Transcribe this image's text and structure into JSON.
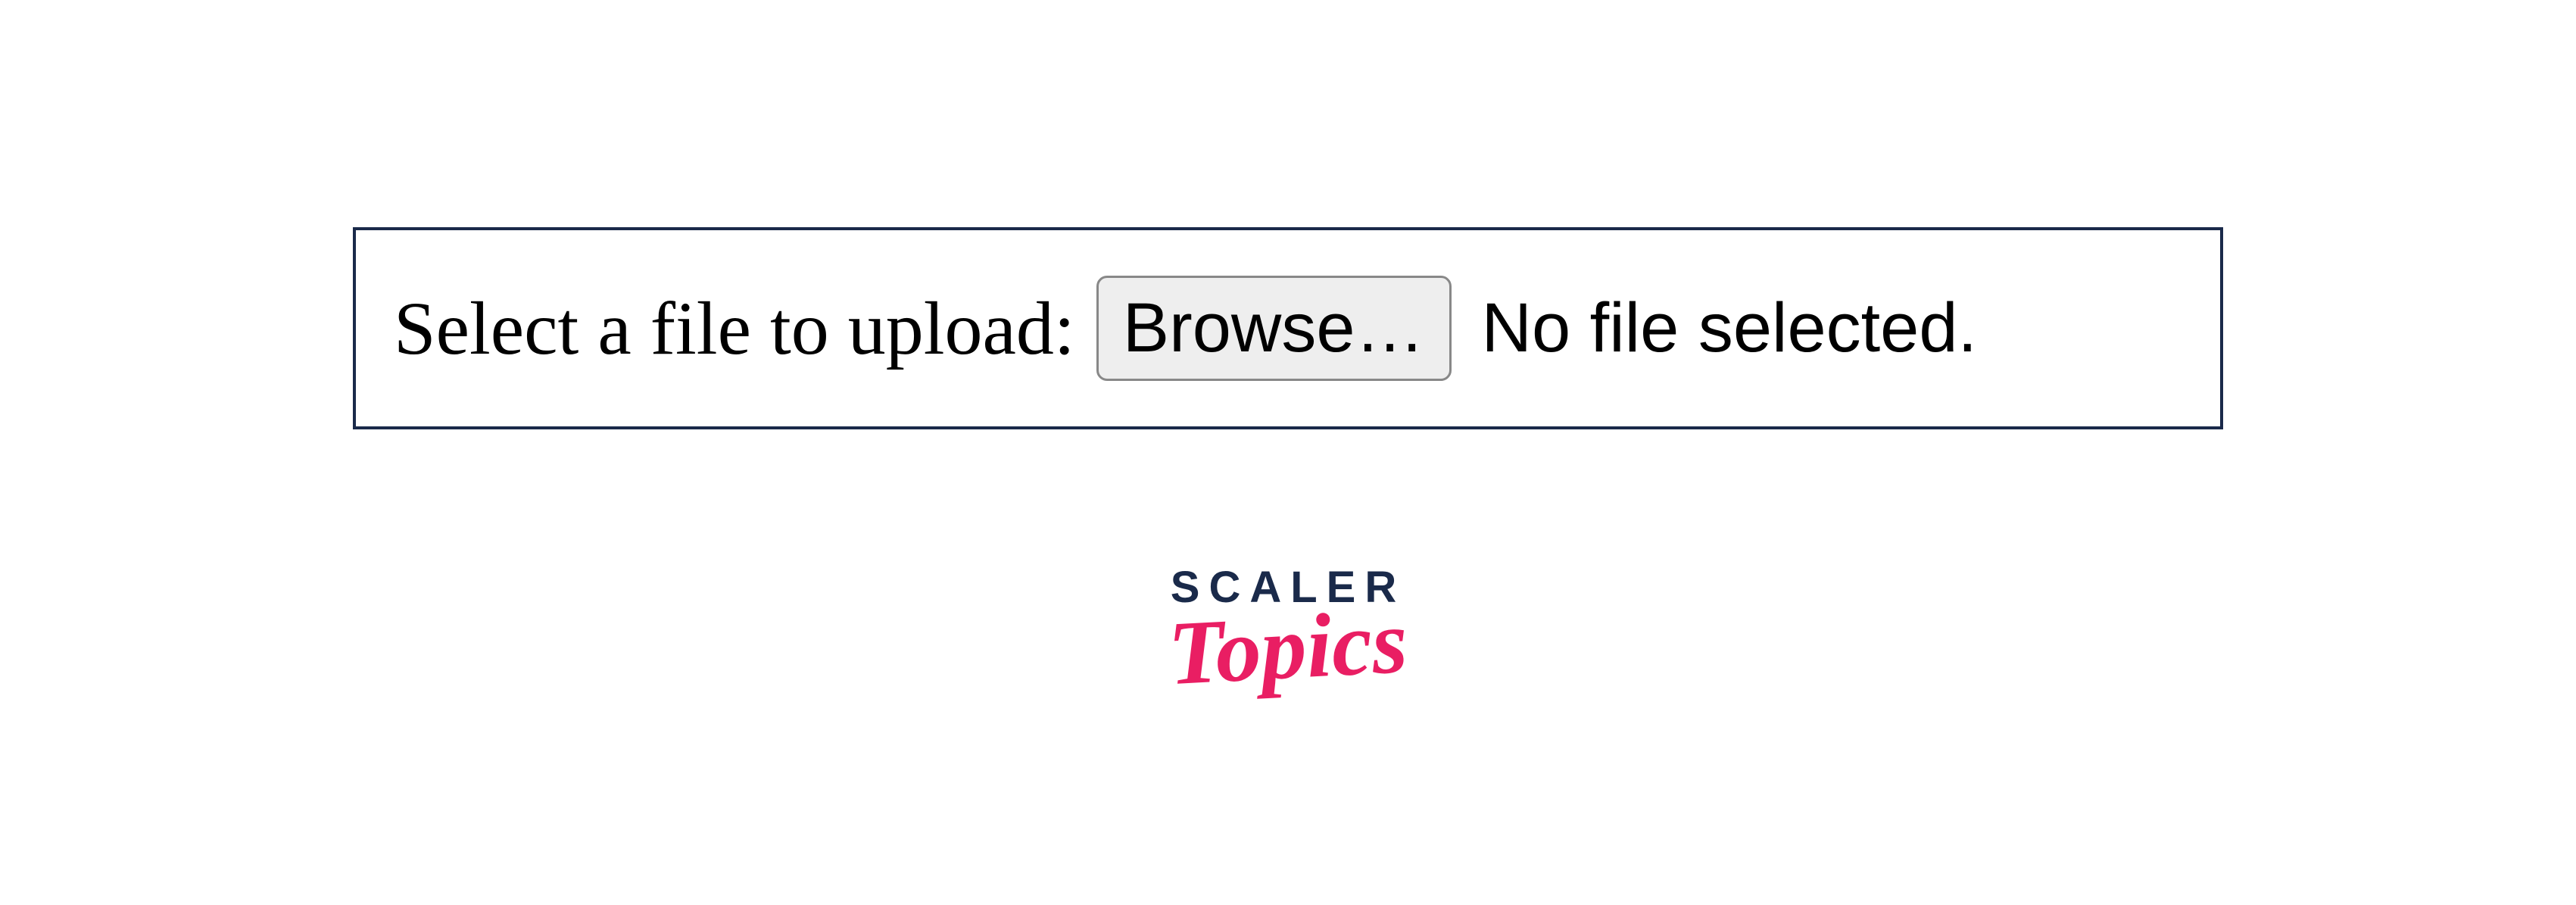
{
  "upload": {
    "label": "Select a file to upload:",
    "browse_button": "Browse…",
    "status": "No file selected."
  },
  "logo": {
    "top": "SCALER",
    "bottom": "Topics"
  }
}
